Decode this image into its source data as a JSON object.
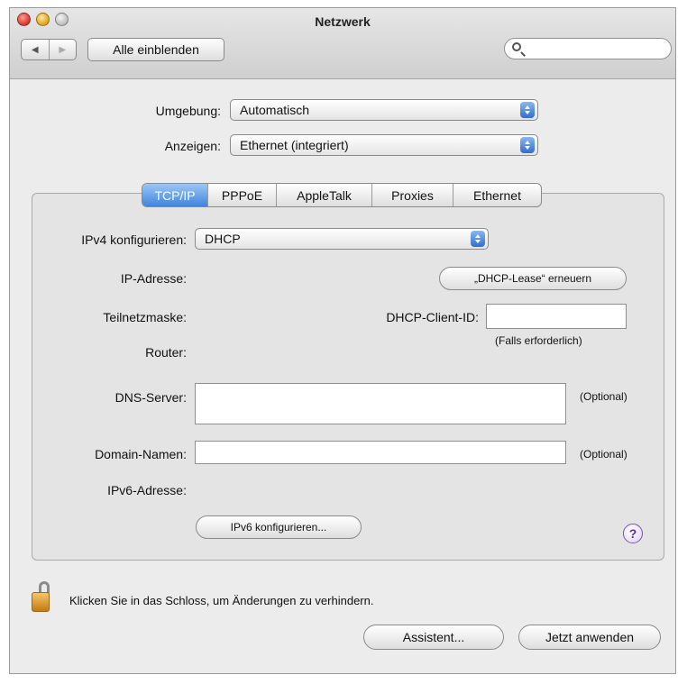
{
  "window": {
    "title": "Netzwerk"
  },
  "toolbar": {
    "show_all_label": "Alle einblenden",
    "back_glyph": "◀",
    "forward_glyph": "▶",
    "search_value": ""
  },
  "location": {
    "label": "Umgebung:",
    "value": "Automatisch"
  },
  "show": {
    "label": "Anzeigen:",
    "value": "Ethernet (integriert)"
  },
  "tabs": [
    "TCP/IP",
    "PPPoE",
    "AppleTalk",
    "Proxies",
    "Ethernet"
  ],
  "active_tab": "TCP/IP",
  "tcpip": {
    "ipv4_label": "IPv4 konfigurieren:",
    "ipv4_value": "DHCP",
    "ip_label": "IP-Adresse:",
    "renew_button": "„DHCP-Lease“ erneuern",
    "subnet_label": "Teilnetzmaske:",
    "client_id_label": "DHCP-Client-ID:",
    "client_id_value": "",
    "client_id_hint": "(Falls erforderlich)",
    "router_label": "Router:",
    "dns_label": "DNS-Server:",
    "dns_value": "",
    "dns_hint": "(Optional)",
    "domain_label": "Domain-Namen:",
    "domain_value": "",
    "domain_hint": "(Optional)",
    "ipv6_label": "IPv6-Adresse:",
    "ipv6_button": "IPv6 konfigurieren..."
  },
  "help_glyph": "?",
  "footer": {
    "lock_text": "Klicken Sie in das Schloss, um Änderungen zu verhindern.",
    "assistant_button": "Assistent...",
    "apply_button": "Jetzt anwenden"
  },
  "colors": {
    "accent": "#3f84dc",
    "window_bg": "#ececec",
    "help": "#5a2f93"
  }
}
